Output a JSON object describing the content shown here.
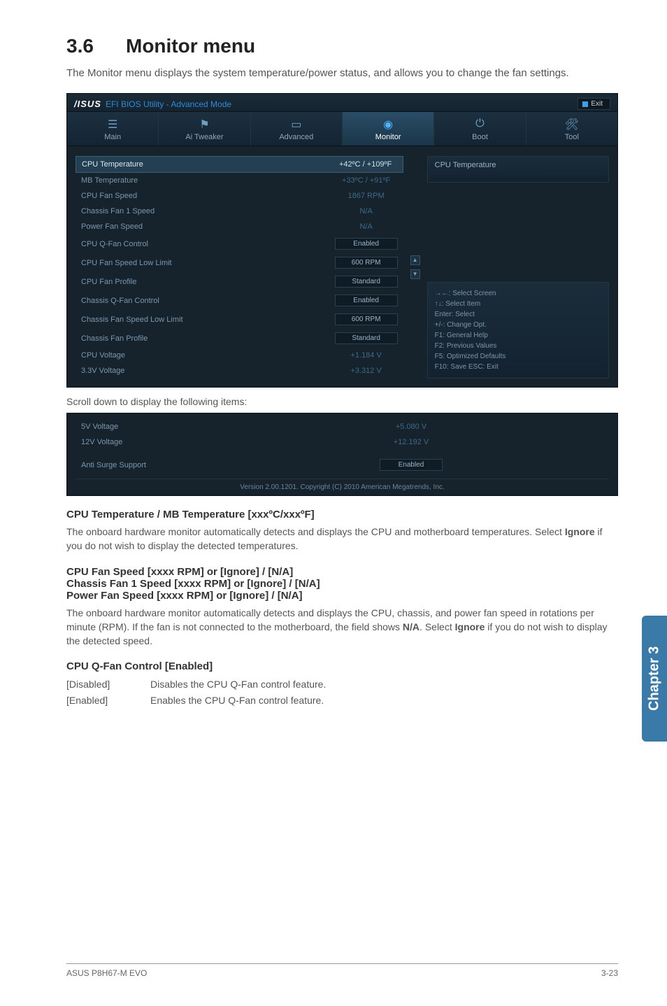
{
  "section": {
    "number": "3.6",
    "title": "Monitor menu"
  },
  "intro": "The Monitor menu displays the system temperature/power status, and allows you to change the fan settings.",
  "bios": {
    "logo": "/ISUS",
    "header_title": "EFI BIOS Utility - Advanced Mode",
    "exit": "Exit",
    "tabs": [
      {
        "label": "Main"
      },
      {
        "label": "Ai Tweaker"
      },
      {
        "label": "Advanced"
      },
      {
        "label": "Monitor"
      },
      {
        "label": "Boot"
      },
      {
        "label": "Tool"
      }
    ],
    "rows": [
      {
        "label": "CPU Temperature",
        "value": "+42ºC / +109ºF",
        "highlight": true,
        "type": "value"
      },
      {
        "label": "MB Temperature",
        "value": "+33ºC / +91ºF",
        "type": "value"
      },
      {
        "label": "CPU Fan Speed",
        "value": "1867 RPM",
        "type": "value"
      },
      {
        "label": "Chassis Fan 1 Speed",
        "value": "N/A",
        "type": "value"
      },
      {
        "label": "Power Fan Speed",
        "value": "N/A",
        "type": "value"
      },
      {
        "label": "CPU Q-Fan Control",
        "value": "Enabled",
        "type": "dropdown"
      },
      {
        "label": "CPU Fan Speed Low Limit",
        "value": "600 RPM",
        "type": "dropdown"
      },
      {
        "label": " CPU Fan Profile",
        "value": "Standard",
        "type": "dropdown"
      },
      {
        "label": "Chassis Q-Fan Control",
        "value": "Enabled",
        "type": "dropdown"
      },
      {
        "label": "Chassis Fan Speed Low Limit",
        "value": "600 RPM",
        "type": "dropdown"
      },
      {
        "label": " Chassis Fan Profile",
        "value": "Standard",
        "type": "dropdown"
      },
      {
        "label": "CPU Voltage",
        "value": "+1.184 V",
        "type": "value"
      },
      {
        "label": "3.3V Voltage",
        "value": "+3.312 V",
        "type": "value"
      }
    ],
    "info_title": "CPU Temperature",
    "hints": [
      "→←: Select Screen",
      "↑↓: Select Item",
      "Enter: Select",
      "+/-: Change Opt.",
      "F1: General Help",
      "F2: Previous Values",
      "F5: Optimized Defaults",
      "F10: Save   ESC: Exit"
    ]
  },
  "scroll_caption": "Scroll down to display the following items:",
  "bios2": {
    "rows": [
      {
        "label": "5V Voltage",
        "value": "+5.080 V",
        "type": "value"
      },
      {
        "label": "12V Voltage",
        "value": "+12.192 V",
        "type": "value"
      },
      {
        "label": "Anti Surge Support",
        "value": "Enabled",
        "type": "dropdown"
      }
    ],
    "footer": "Version 2.00.1201. Copyright (C) 2010 American Megatrends, Inc."
  },
  "chapter_tab": "Chapter 3",
  "subsections": {
    "cpu_temp": {
      "heading": "CPU Temperature / MB Temperature [xxxºC/xxxºF]",
      "body_pre": "The onboard hardware monitor automatically detects and displays the CPU and motherboard temperatures. Select ",
      "body_bold": "Ignore",
      "body_post": " if you do not wish to display the detected temperatures."
    },
    "fan_speed": {
      "h1": "CPU Fan Speed [xxxx RPM] or [Ignore] / [N/A]",
      "h2": "Chassis Fan 1 Speed [xxxx RPM] or [Ignore] / [N/A]",
      "h3": "Power Fan Speed [xxxx RPM] or [Ignore] / [N/A]",
      "body_pre": "The onboard hardware monitor automatically detects and displays the CPU, chassis, and power fan speed in rotations per minute (RPM). If the fan is not connected to the motherboard, the field shows ",
      "na_bold": "N/A",
      "mid": ". Select ",
      "ignore_bold": "Ignore",
      "body_post": " if you do not wish to display the detected speed."
    },
    "qfan": {
      "heading": "CPU Q-Fan Control [Enabled]",
      "disabled_term": "[Disabled]",
      "disabled_desc": "Disables the CPU Q-Fan control feature.",
      "enabled_term": "[Enabled]",
      "enabled_desc": "Enables the CPU Q-Fan control feature."
    }
  },
  "footer": {
    "left": "ASUS P8H67-M EVO",
    "right": "3-23"
  }
}
